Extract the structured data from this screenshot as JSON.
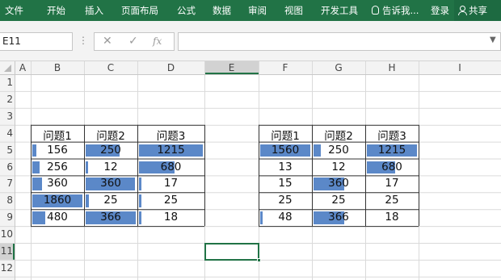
{
  "ribbon": {
    "tabs": [
      "文件",
      "开始",
      "插入",
      "页面布局",
      "公式",
      "数据",
      "审阅",
      "视图",
      "开发工具"
    ],
    "tell_me": "告诉我...",
    "login": "登录",
    "share": "共享"
  },
  "formula_bar": {
    "name_box": "E11",
    "cancel_icon": "✕",
    "enter_icon": "✓",
    "fx_label": "fx",
    "formula": ""
  },
  "sheet": {
    "columns": [
      "A",
      "B",
      "C",
      "D",
      "E",
      "F",
      "G",
      "H",
      "I"
    ],
    "rows": [
      "1",
      "2",
      "3",
      "4",
      "5",
      "6",
      "7",
      "8",
      "9",
      "10",
      "11",
      "12"
    ],
    "selected_cell": "E11",
    "colors": {
      "data_bar": "#5b88c8",
      "ribbon": "#217346",
      "selection": "#217346"
    },
    "left_table": {
      "headers": [
        "问题1",
        "问题2",
        "问题3"
      ],
      "rows": [
        [
          "156",
          "250",
          "1215"
        ],
        [
          "256",
          "12",
          "680"
        ],
        [
          "360",
          "360",
          "17"
        ],
        [
          "1860",
          "25",
          "25"
        ],
        [
          "480",
          "366",
          "18"
        ]
      ],
      "bar_fraction": [
        [
          0.084,
          0.683,
          1.0
        ],
        [
          0.138,
          0.033,
          0.56
        ],
        [
          0.194,
          0.984,
          0.014
        ],
        [
          1.0,
          0.068,
          0.021
        ],
        [
          0.258,
          1.0,
          0.015
        ]
      ]
    },
    "right_table": {
      "headers": [
        "问题1",
        "问题2",
        "问题3"
      ],
      "rows": [
        [
          "1560",
          "250",
          "1215"
        ],
        [
          "13",
          "12",
          "680"
        ],
        [
          "15",
          "360",
          "17"
        ],
        [
          "25",
          "25",
          "25"
        ],
        [
          "48",
          "366",
          "18"
        ]
      ],
      "bar_fraction": [
        [
          1.0,
          0.15,
          1.0
        ],
        [
          0.0,
          0.0,
          0.56
        ],
        [
          0.0,
          0.62,
          0.0
        ],
        [
          0.0,
          0.0,
          0.0
        ],
        [
          0.02,
          0.62,
          0.0
        ]
      ]
    }
  }
}
